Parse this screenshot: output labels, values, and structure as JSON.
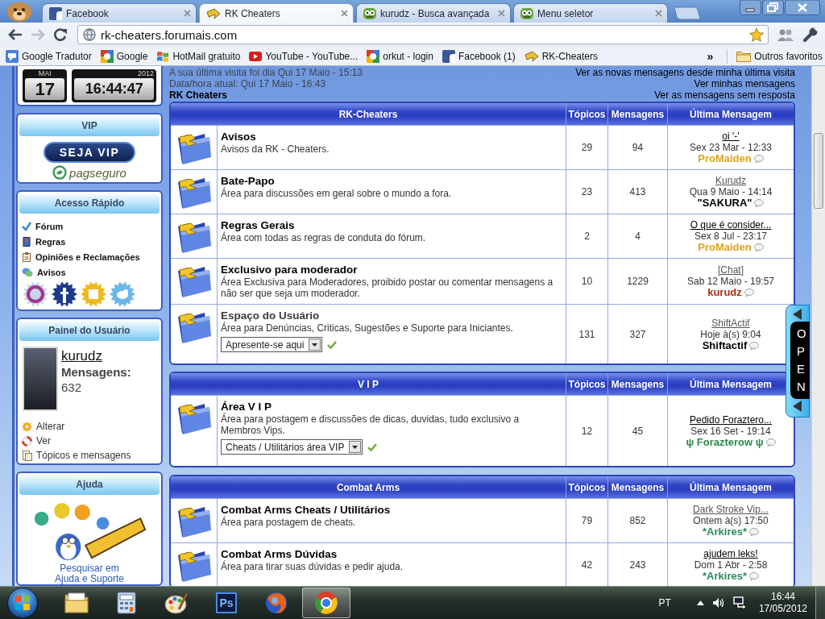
{
  "browser": {
    "tabs": [
      {
        "title": "Facebook",
        "selected": false
      },
      {
        "title": "RK Cheaters",
        "selected": true
      },
      {
        "title": "kurudz - Busca avançada",
        "selected": false
      },
      {
        "title": "Menu seletor",
        "selected": false
      }
    ],
    "address": "rk-cheaters.forumais.com",
    "bookmarks": [
      "Google Tradutor",
      "Google",
      "HotMail gratuito",
      "YouTube - YouTube...",
      "orkut - login",
      "Facebook (1)",
      "RK-Cheaters"
    ],
    "bookmarks_overflow": "»",
    "other_bookmarks": "Outros favoritos"
  },
  "sidebar": {
    "clock": {
      "month": "MAI",
      "day": "17",
      "year": "2012",
      "time": "16:44:47"
    },
    "vip": {
      "title": "VIP",
      "button": "SEJA VIP",
      "payment_logo": "pagseguro"
    },
    "quick_access": {
      "title": "Acesso Rápido",
      "links": [
        "Fórum",
        "Regras",
        "Opiniões e Reclamações",
        "Avisos"
      ]
    },
    "user_panel": {
      "title": "Painel do Usuário",
      "username": "kurudz",
      "posts_label": "Mensagens:",
      "posts": "632",
      "links": [
        "Alterar",
        "Ver",
        "Tópicos e mensagens"
      ]
    },
    "help": {
      "title": "Ajuda",
      "link": "Pesquisar em Ajuda e Suporte"
    }
  },
  "main": {
    "visit_info": {
      "last_visit": "A sua última visita foi dia Qui 17 Maio - 15:13",
      "current_time": "Data/hora atual: Qui 17 Maio - 16:43",
      "forum_name": "RK Cheaters"
    },
    "quick_links": [
      "Ver as novas mensagens desde minha última visita",
      "Ver minhas mensagens",
      "Ver as mensagens sem resposta"
    ],
    "categories": [
      {
        "title": "RK-Cheaters",
        "columns": [
          "Tópicos",
          "Mensagens",
          "Última Mensagem"
        ],
        "forums": [
          {
            "name": "Avisos",
            "visited": false,
            "description": "Avisos da RK - Cheaters.",
            "topics": "29",
            "posts": "94",
            "last_post": {
              "title": "oi '-'",
              "visited": false,
              "date": "Sex 23 Mar - 12:33",
              "author": "ProMaiden",
              "color": "#e0a41c"
            }
          },
          {
            "name": "Bate-Papo",
            "visited": false,
            "description": "Área para discussões em geral sobre o mundo a fora.",
            "topics": "23",
            "posts": "413",
            "last_post": {
              "title": "Kurudz",
              "visited": true,
              "date": "Qua 9 Maio - 14:14",
              "author": "\"SAKURA\"",
              "color": "#000000"
            }
          },
          {
            "name": "Regras Gerais",
            "visited": false,
            "description": "Área com todas as regras de conduta do fórum.",
            "topics": "2",
            "posts": "4",
            "last_post": {
              "title": "O que é consider...",
              "visited": false,
              "date": "Sex 8 Jul - 23:17",
              "author": "ProMaiden",
              "color": "#e0a41c"
            }
          },
          {
            "name": "Exclusivo para moderador",
            "visited": false,
            "description": "Área Exclusiva para Moderadores, proibido postar ou comentar mensagens a não ser que seja um moderador.",
            "topics": "10",
            "posts": "1229",
            "last_post": {
              "title": "[Chat]",
              "visited": true,
              "date": "Sab 12 Maio - 19:57",
              "author": "kurudz",
              "color": "#a8301a"
            }
          },
          {
            "name": "Espaço do Usuário",
            "visited": true,
            "description": "Área para Denúncias, Criticas, Sugestões e Suporte para Iniciantes.",
            "subforum": "Apresente-se aqui",
            "topics": "131",
            "posts": "327",
            "last_post": {
              "title": "ShiftActif",
              "visited": true,
              "date": "Hoje à(s) 9:04",
              "author": "Shiftactif",
              "color": "#000000"
            }
          }
        ]
      },
      {
        "title": "V I P",
        "columns": [
          "Tópicos",
          "Mensagens",
          "Última Mensagem"
        ],
        "forums": [
          {
            "name": "Área V I P",
            "visited": false,
            "description": "Área para postagem e discussões de dicas, duvidas, tudo exclusivo a Membros Vips.",
            "subforum": "Cheats / Utilitários área VIP",
            "topics": "12",
            "posts": "45",
            "last_post": {
              "title": "Pedido Foraztero...",
              "visited": false,
              "date": "Sex 16 Set - 19:14",
              "author": "ψ Forazterow ψ",
              "color": "#2a8a4a"
            }
          }
        ]
      },
      {
        "title": "Combat Arms",
        "columns": [
          "Tópicos",
          "Mensagens",
          "Última Mensagem"
        ],
        "forums": [
          {
            "name": "Combat Arms Cheats / Utilitários",
            "visited": false,
            "description": "Área para postagem de cheats.",
            "topics": "79",
            "posts": "852",
            "last_post": {
              "title": "Dark Stroke Vip...",
              "visited": true,
              "date": "Ontem à(s) 17:50",
              "author": "*Arkires*",
              "color": "#2a8a5e"
            }
          },
          {
            "name": "Combat Arms Dúvidas",
            "visited": false,
            "description": "Área para tirar suas dúvidas e pedir ajuda.",
            "topics": "42",
            "posts": "243",
            "last_post": {
              "title": "ajudem leks!",
              "visited": false,
              "date": "Dom 1 Abr - 2:58",
              "author": "*Arkires*",
              "color": "#2a8a5e"
            }
          }
        ]
      }
    ]
  },
  "side_tab": {
    "label": "OPEN"
  },
  "taskbar": {
    "apps": [
      {
        "selected": false
      },
      {
        "selected": false
      },
      {
        "selected": false
      },
      {
        "label": "Ps",
        "selected": false
      },
      {
        "selected": false
      },
      {
        "selected": true
      }
    ],
    "language": "PT",
    "time": "16:44",
    "date": "17/05/2012"
  }
}
